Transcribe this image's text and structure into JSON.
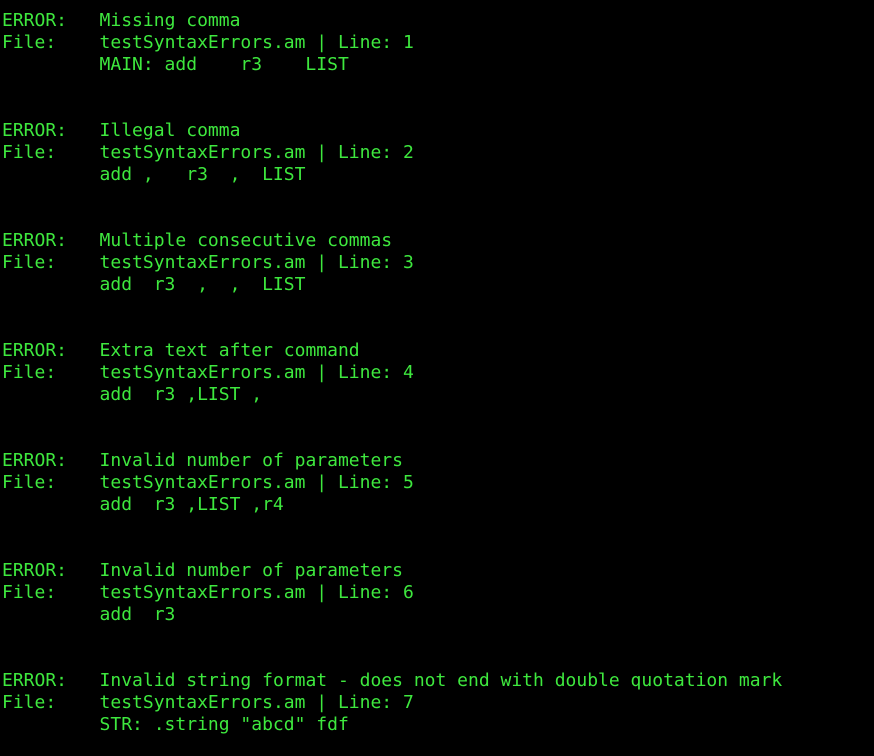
{
  "terminal": {
    "separator": "------------------------------------------------",
    "text_color": "#3ee83e",
    "background": "#000000",
    "errors": [
      {
        "error_label": "ERROR:   ",
        "message": "Missing comma",
        "file_label": "File:    ",
        "file_info": "testSyntaxErrors.am | Line: 1",
        "source_line": "         MAIN: add    r3    LIST"
      },
      {
        "error_label": "ERROR:   ",
        "message": "Illegal comma",
        "file_label": "File:    ",
        "file_info": "testSyntaxErrors.am | Line: 2",
        "source_line": "         add ,   r3  ,  LIST"
      },
      {
        "error_label": "ERROR:   ",
        "message": "Multiple consecutive commas",
        "file_label": "File:    ",
        "file_info": "testSyntaxErrors.am | Line: 3",
        "source_line": "         add  r3  ,  ,  LIST"
      },
      {
        "error_label": "ERROR:   ",
        "message": "Extra text after command",
        "file_label": "File:    ",
        "file_info": "testSyntaxErrors.am | Line: 4",
        "source_line": "         add  r3 ,LIST ,"
      },
      {
        "error_label": "ERROR:   ",
        "message": "Invalid number of parameters",
        "file_label": "File:    ",
        "file_info": "testSyntaxErrors.am | Line: 5",
        "source_line": "         add  r3 ,LIST ,r4"
      },
      {
        "error_label": "ERROR:   ",
        "message": "Invalid number of parameters",
        "file_label": "File:    ",
        "file_info": "testSyntaxErrors.am | Line: 6",
        "source_line": "         add  r3"
      },
      {
        "error_label": "ERROR:   ",
        "message": "Invalid string format - does not end with double quotation mark",
        "file_label": "File:    ",
        "file_info": "testSyntaxErrors.am | Line: 7",
        "source_line": "         STR: .string \"abcd\" fdf"
      }
    ]
  }
}
